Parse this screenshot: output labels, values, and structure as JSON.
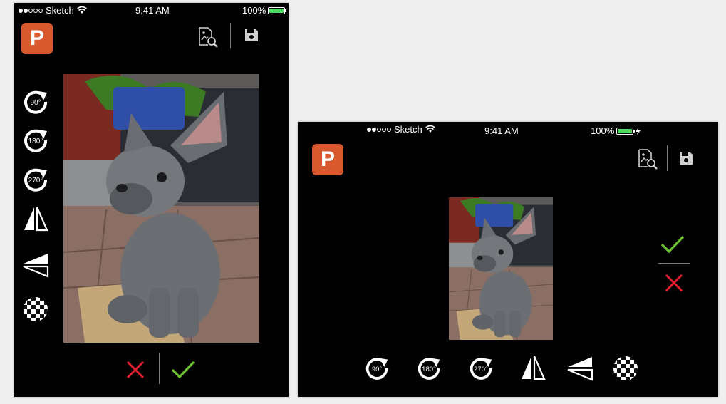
{
  "colors": {
    "accent": "#d9592f",
    "confirm": "#6ec531",
    "cancel": "#e0202f",
    "battery": "#4cd964"
  },
  "status": {
    "carrier": "Sketch",
    "time": "9:41 AM",
    "battery": "100%"
  },
  "logo": {
    "letter": "P"
  },
  "icons": {
    "search_image": "image-search-icon",
    "save": "save-icon",
    "rotate_90": "rotate-90-icon",
    "rotate_180": "rotate-180-icon",
    "rotate_270": "rotate-270-icon",
    "flip_h": "flip-horizontal-icon",
    "flip_v": "flip-vertical-icon",
    "transparency": "checkerboard-icon",
    "cancel": "close-icon",
    "confirm": "check-icon"
  },
  "rotate": {
    "r90": "90°",
    "r180": "180°",
    "r270": "270°"
  },
  "photo": {
    "subject": "French bulldog puppy"
  }
}
